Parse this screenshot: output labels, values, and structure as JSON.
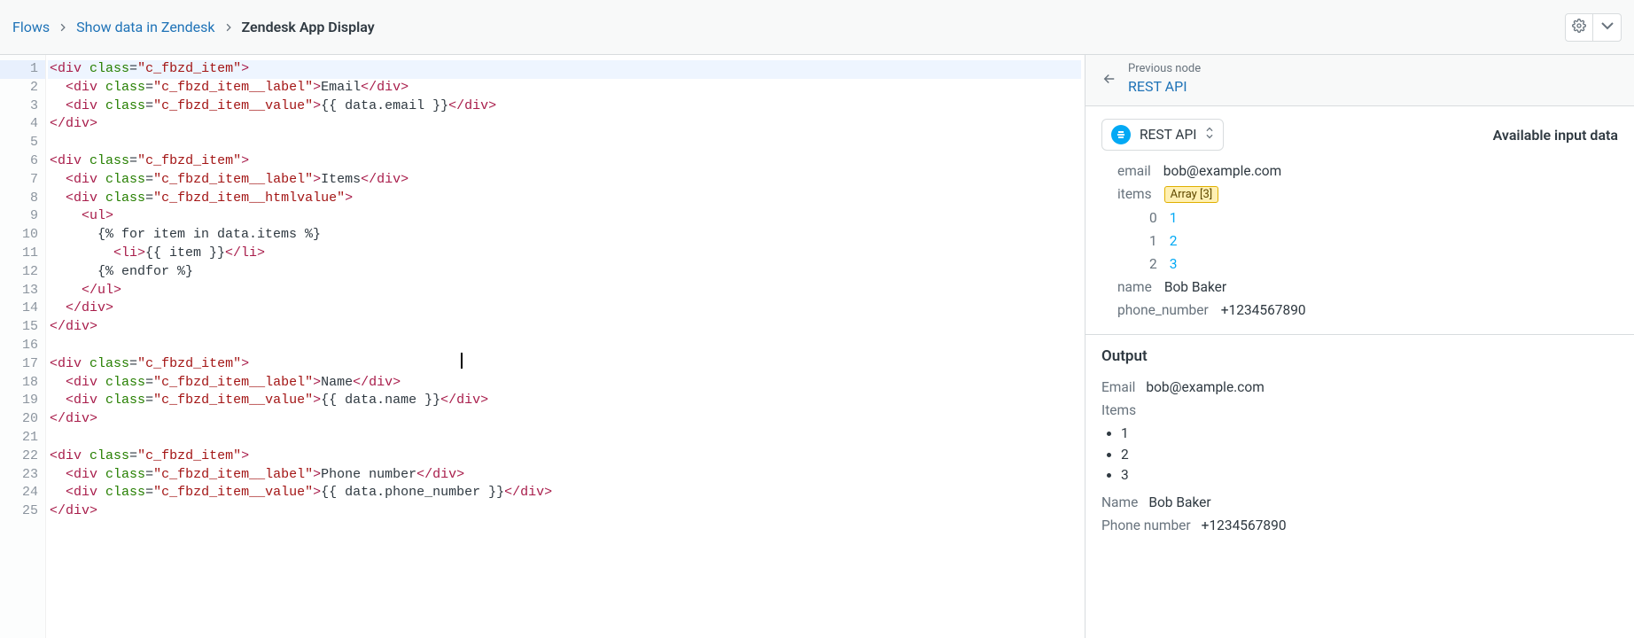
{
  "breadcrumb": {
    "root": "Flows",
    "parent": "Show data in Zendesk",
    "current": "Zendesk App Display"
  },
  "previous_node": {
    "label": "Previous node",
    "name": "REST API"
  },
  "node_selector": {
    "name": "REST API"
  },
  "available_title": "Available input data",
  "input_data": {
    "email_key": "email",
    "email_val": "bob@example.com",
    "items_key": "items",
    "items_badge": "Array [3]",
    "items": [
      {
        "idx": "0",
        "val": "1"
      },
      {
        "idx": "1",
        "val": "2"
      },
      {
        "idx": "2",
        "val": "3"
      }
    ],
    "name_key": "name",
    "name_val": "Bob Baker",
    "phone_key": "phone_number",
    "phone_val": "+1234567890"
  },
  "output": {
    "title": "Output",
    "email_key": "Email",
    "email_val": "bob@example.com",
    "items_key": "Items",
    "items": [
      "1",
      "2",
      "3"
    ],
    "name_key": "Name",
    "name_val": "Bob Baker",
    "phone_key": "Phone number",
    "phone_val": "+1234567890"
  },
  "code_lines": [
    {
      "n": 1,
      "hl": true,
      "tokens": [
        [
          "tag",
          "<div"
        ],
        [
          "txt",
          " "
        ],
        [
          "attr",
          "class"
        ],
        [
          "txt",
          "="
        ],
        [
          "strg",
          "\"c_fbzd_item\""
        ],
        [
          "tag",
          ">"
        ]
      ]
    },
    {
      "n": 2,
      "hl": false,
      "tokens": [
        [
          "txt",
          "  "
        ],
        [
          "tag",
          "<div"
        ],
        [
          "txt",
          " "
        ],
        [
          "attr",
          "class"
        ],
        [
          "txt",
          "="
        ],
        [
          "strg",
          "\"c_fbzd_item__label\""
        ],
        [
          "tag",
          ">"
        ],
        [
          "txt",
          "Email"
        ],
        [
          "tag",
          "</div>"
        ]
      ]
    },
    {
      "n": 3,
      "hl": false,
      "tokens": [
        [
          "txt",
          "  "
        ],
        [
          "tag",
          "<div"
        ],
        [
          "txt",
          " "
        ],
        [
          "attr",
          "class"
        ],
        [
          "txt",
          "="
        ],
        [
          "strg",
          "\"c_fbzd_item__value\""
        ],
        [
          "tag",
          ">"
        ],
        [
          "tmpl",
          "{{ data.email }}"
        ],
        [
          "tag",
          "</div>"
        ]
      ]
    },
    {
      "n": 4,
      "hl": false,
      "tokens": [
        [
          "tag",
          "</div>"
        ]
      ]
    },
    {
      "n": 5,
      "hl": false,
      "tokens": [
        [
          "txt",
          ""
        ]
      ]
    },
    {
      "n": 6,
      "hl": false,
      "tokens": [
        [
          "tag",
          "<div"
        ],
        [
          "txt",
          " "
        ],
        [
          "attr",
          "class"
        ],
        [
          "txt",
          "="
        ],
        [
          "strg",
          "\"c_fbzd_item\""
        ],
        [
          "tag",
          ">"
        ]
      ]
    },
    {
      "n": 7,
      "hl": false,
      "tokens": [
        [
          "txt",
          "  "
        ],
        [
          "tag",
          "<div"
        ],
        [
          "txt",
          " "
        ],
        [
          "attr",
          "class"
        ],
        [
          "txt",
          "="
        ],
        [
          "strg",
          "\"c_fbzd_item__label\""
        ],
        [
          "tag",
          ">"
        ],
        [
          "txt",
          "Items"
        ],
        [
          "tag",
          "</div>"
        ]
      ]
    },
    {
      "n": 8,
      "hl": false,
      "tokens": [
        [
          "txt",
          "  "
        ],
        [
          "tag",
          "<div"
        ],
        [
          "txt",
          " "
        ],
        [
          "attr",
          "class"
        ],
        [
          "txt",
          "="
        ],
        [
          "strg",
          "\"c_fbzd_item__htmlvalue\""
        ],
        [
          "tag",
          ">"
        ]
      ]
    },
    {
      "n": 9,
      "hl": false,
      "tokens": [
        [
          "txt",
          "    "
        ],
        [
          "tag",
          "<ul>"
        ]
      ]
    },
    {
      "n": 10,
      "hl": false,
      "tokens": [
        [
          "txt",
          "      "
        ],
        [
          "tmpl",
          "{% for item in data.items %}"
        ]
      ]
    },
    {
      "n": 11,
      "hl": false,
      "tokens": [
        [
          "txt",
          "        "
        ],
        [
          "tag",
          "<li>"
        ],
        [
          "tmpl",
          "{{ item }}"
        ],
        [
          "tag",
          "</li>"
        ]
      ]
    },
    {
      "n": 12,
      "hl": false,
      "tokens": [
        [
          "txt",
          "      "
        ],
        [
          "tmpl",
          "{% endfor %}"
        ]
      ]
    },
    {
      "n": 13,
      "hl": false,
      "tokens": [
        [
          "txt",
          "    "
        ],
        [
          "tag",
          "</ul>"
        ]
      ]
    },
    {
      "n": 14,
      "hl": false,
      "tokens": [
        [
          "txt",
          "  "
        ],
        [
          "tag",
          "</div>"
        ]
      ]
    },
    {
      "n": 15,
      "hl": false,
      "tokens": [
        [
          "tag",
          "</div>"
        ]
      ]
    },
    {
      "n": 16,
      "hl": false,
      "tokens": [
        [
          "txt",
          ""
        ]
      ]
    },
    {
      "n": 17,
      "hl": false,
      "tokens": [
        [
          "tag",
          "<div"
        ],
        [
          "txt",
          " "
        ],
        [
          "attr",
          "class"
        ],
        [
          "txt",
          "="
        ],
        [
          "strg",
          "\"c_fbzd_item\""
        ],
        [
          "tag",
          ">"
        ]
      ]
    },
    {
      "n": 18,
      "hl": false,
      "tokens": [
        [
          "txt",
          "  "
        ],
        [
          "tag",
          "<div"
        ],
        [
          "txt",
          " "
        ],
        [
          "attr",
          "class"
        ],
        [
          "txt",
          "="
        ],
        [
          "strg",
          "\"c_fbzd_item__label\""
        ],
        [
          "tag",
          ">"
        ],
        [
          "txt",
          "Name"
        ],
        [
          "tag",
          "</div>"
        ]
      ]
    },
    {
      "n": 19,
      "hl": false,
      "tokens": [
        [
          "txt",
          "  "
        ],
        [
          "tag",
          "<div"
        ],
        [
          "txt",
          " "
        ],
        [
          "attr",
          "class"
        ],
        [
          "txt",
          "="
        ],
        [
          "strg",
          "\"c_fbzd_item__value\""
        ],
        [
          "tag",
          ">"
        ],
        [
          "tmpl",
          "{{ data.name }}"
        ],
        [
          "tag",
          "</div>"
        ]
      ]
    },
    {
      "n": 20,
      "hl": false,
      "tokens": [
        [
          "tag",
          "</div>"
        ]
      ]
    },
    {
      "n": 21,
      "hl": false,
      "tokens": [
        [
          "txt",
          ""
        ]
      ]
    },
    {
      "n": 22,
      "hl": false,
      "tokens": [
        [
          "tag",
          "<div"
        ],
        [
          "txt",
          " "
        ],
        [
          "attr",
          "class"
        ],
        [
          "txt",
          "="
        ],
        [
          "strg",
          "\"c_fbzd_item\""
        ],
        [
          "tag",
          ">"
        ]
      ]
    },
    {
      "n": 23,
      "hl": false,
      "tokens": [
        [
          "txt",
          "  "
        ],
        [
          "tag",
          "<div"
        ],
        [
          "txt",
          " "
        ],
        [
          "attr",
          "class"
        ],
        [
          "txt",
          "="
        ],
        [
          "strg",
          "\"c_fbzd_item__label\""
        ],
        [
          "tag",
          ">"
        ],
        [
          "txt",
          "Phone number"
        ],
        [
          "tag",
          "</div>"
        ]
      ]
    },
    {
      "n": 24,
      "hl": false,
      "tokens": [
        [
          "txt",
          "  "
        ],
        [
          "tag",
          "<div"
        ],
        [
          "txt",
          " "
        ],
        [
          "attr",
          "class"
        ],
        [
          "txt",
          "="
        ],
        [
          "strg",
          "\"c_fbzd_item__value\""
        ],
        [
          "tag",
          ">"
        ],
        [
          "tmpl",
          "{{ data.phone_number }}"
        ],
        [
          "tag",
          "</div>"
        ]
      ]
    },
    {
      "n": 25,
      "hl": false,
      "tokens": [
        [
          "tag",
          "</div>"
        ]
      ]
    }
  ]
}
